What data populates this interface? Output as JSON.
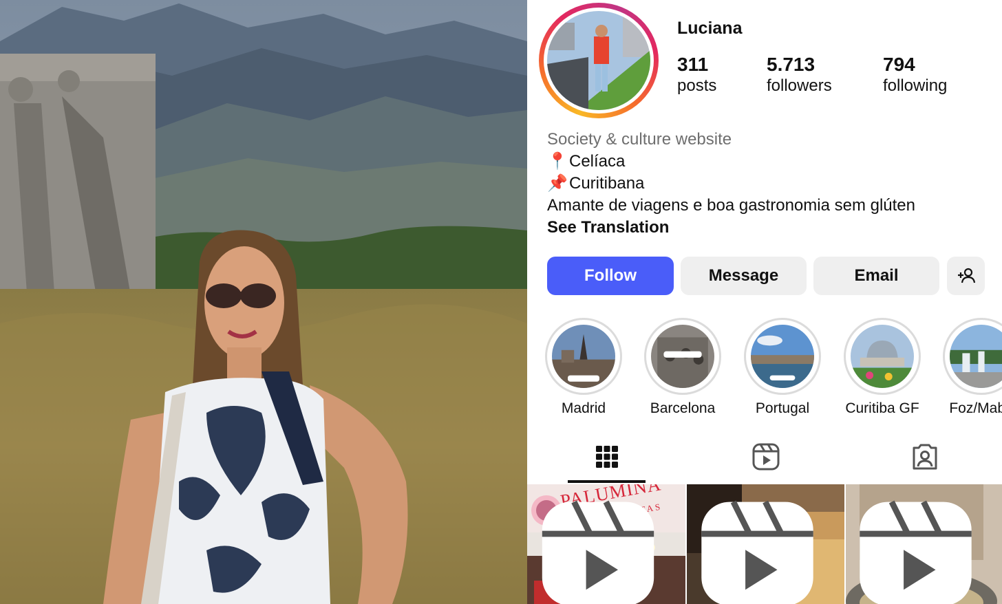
{
  "profile": {
    "username": "Luciana",
    "stats": [
      {
        "value": "311",
        "label": "posts"
      },
      {
        "value": "5.713",
        "label": "followers"
      },
      {
        "value": "794",
        "label": "following"
      }
    ],
    "bio": {
      "category": "Society & culture website",
      "line1_emoji": "📍",
      "line1": "Celíaca",
      "line2_emoji": "📌",
      "line2": "Curitibana",
      "line3": "Amante de viagens e boa gastronomia sem glúten",
      "see_translation": "See Translation"
    }
  },
  "actions": {
    "follow": "Follow",
    "message": "Message",
    "email": "Email",
    "add_person_icon": "add-person-icon"
  },
  "highlights": [
    {
      "label": "Madrid"
    },
    {
      "label": "Barcelona"
    },
    {
      "label": "Portugal"
    },
    {
      "label": "Curitiba GF"
    },
    {
      "label": "Foz/Mabu"
    }
  ],
  "tabs": [
    {
      "icon": "grid-icon",
      "active": true
    },
    {
      "icon": "reels-icon",
      "active": false
    },
    {
      "icon": "tagged-icon",
      "active": false
    }
  ],
  "posts": [
    {
      "sign_text": "PALUMINA",
      "sign_subtext": "TORTAS",
      "type": "reel"
    },
    {
      "type": "reel"
    },
    {
      "type": "reel"
    }
  ],
  "colors": {
    "follow_button": "#4a5df9",
    "secondary_button": "#efefef",
    "category_text": "#6e6e6e"
  }
}
